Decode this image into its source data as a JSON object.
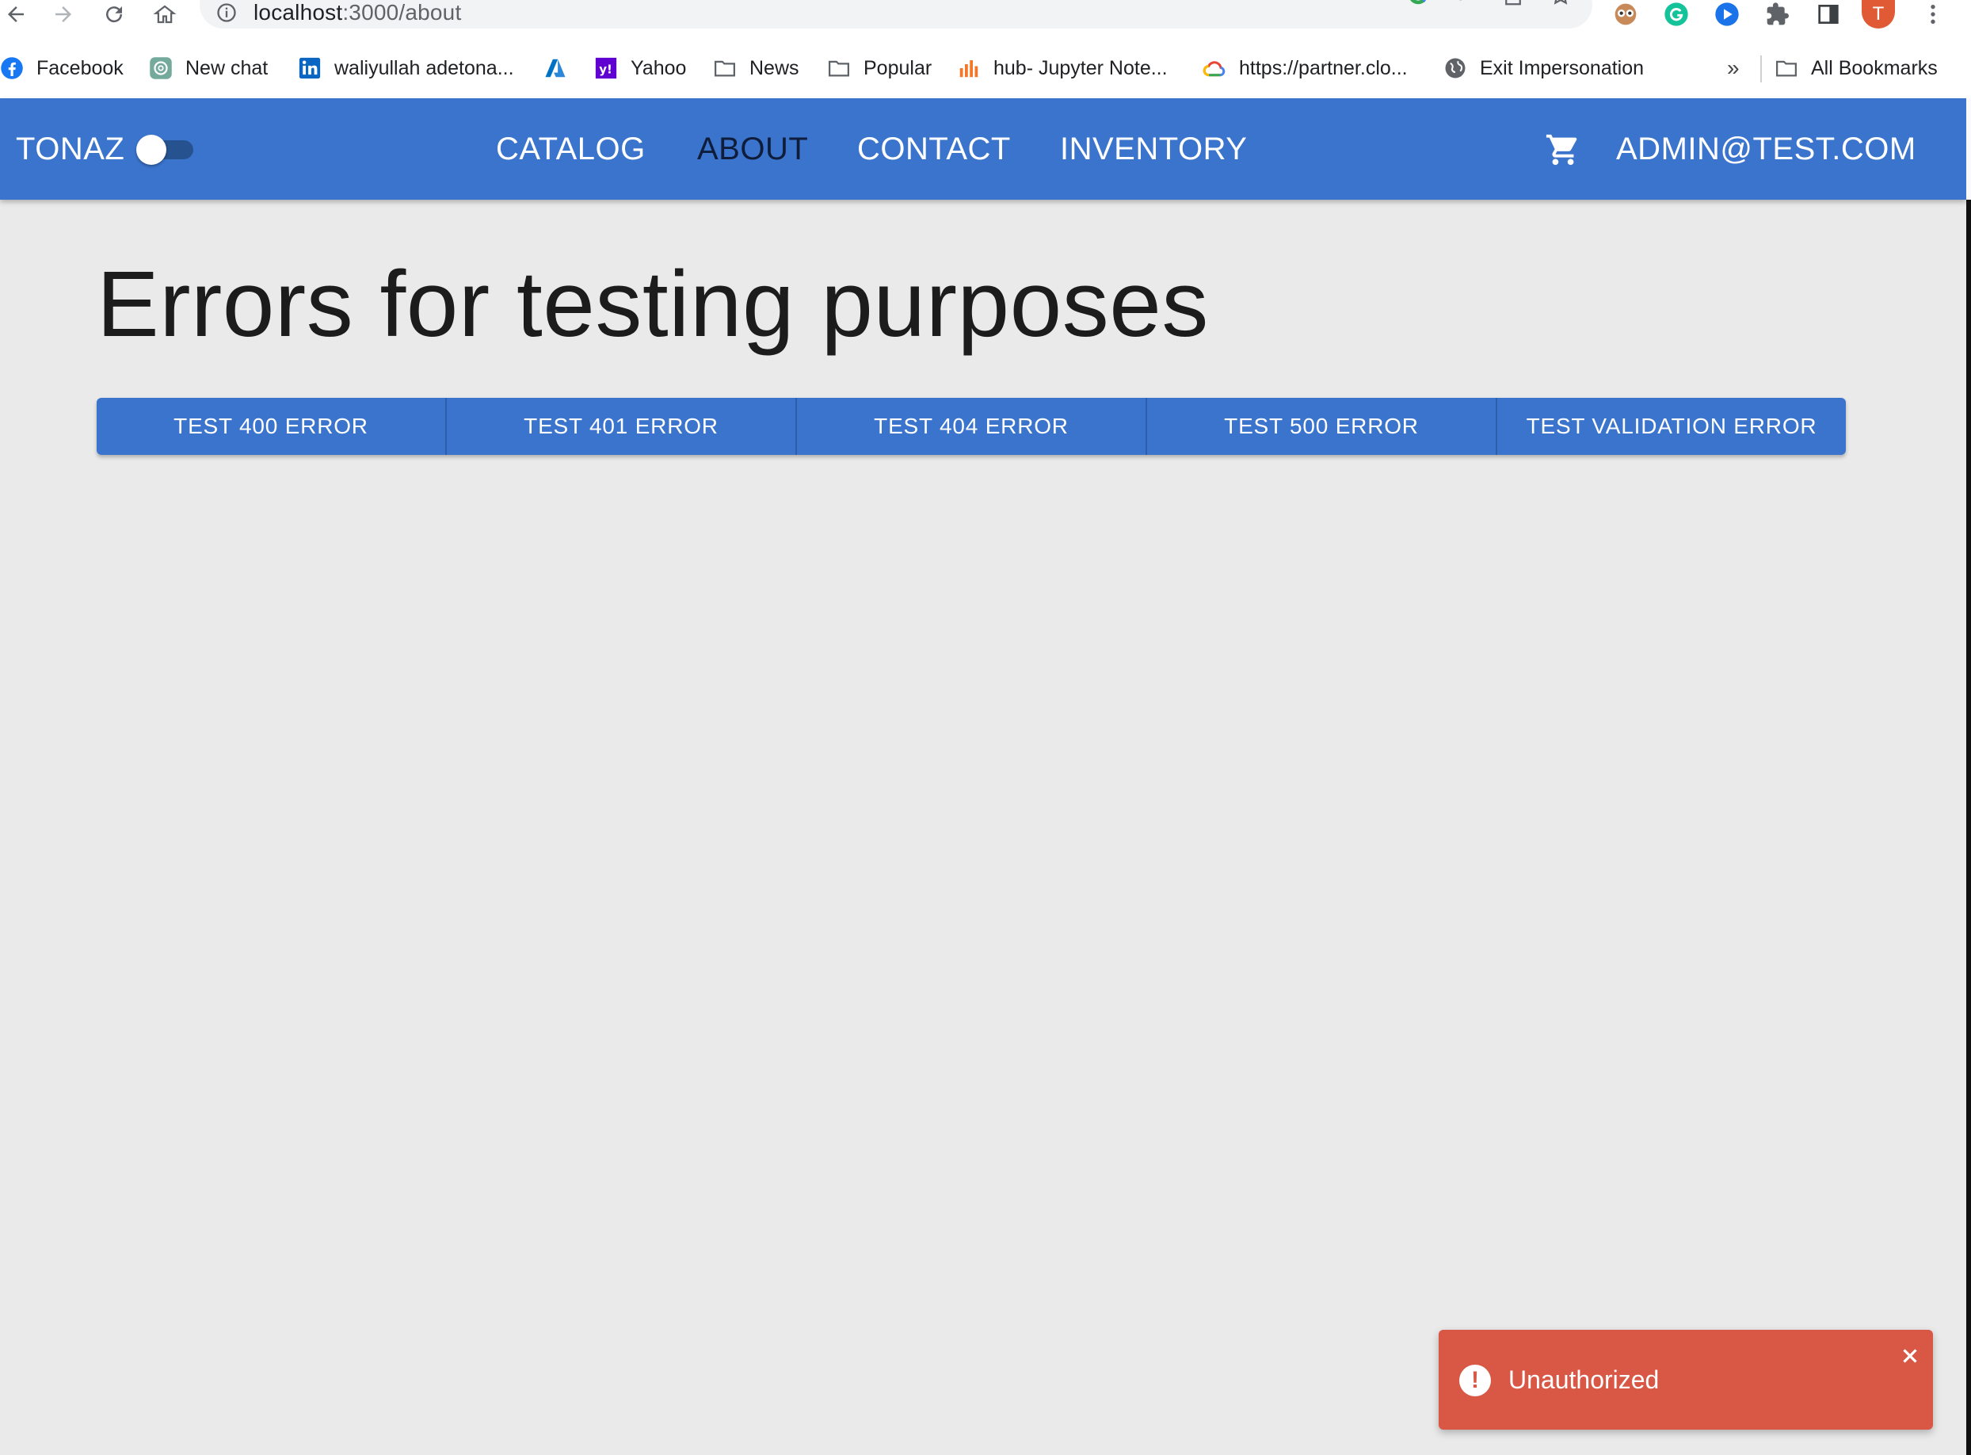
{
  "browser": {
    "url_host": "localhost",
    "url_path": ":3000/about",
    "profile_initial": "T"
  },
  "bookmarks": {
    "items": [
      {
        "label": "Facebook",
        "icon": "facebook-icon"
      },
      {
        "label": "New chat",
        "icon": "openai-icon"
      },
      {
        "label": "waliyullah adetona...",
        "icon": "linkedin-icon"
      },
      {
        "label": "",
        "icon": "azure-icon"
      },
      {
        "label": "Yahoo",
        "icon": "yahoo-icon"
      },
      {
        "label": "News",
        "icon": "folder-icon"
      },
      {
        "label": "Popular",
        "icon": "folder-icon"
      },
      {
        "label": "hub- Jupyter Note...",
        "icon": "chart-icon"
      },
      {
        "label": "https://partner.clo...",
        "icon": "cloud-icon"
      },
      {
        "label": "Exit Impersonation",
        "icon": "globe-icon"
      }
    ],
    "more": "»",
    "all_bookmarks": "All Bookmarks"
  },
  "appbar": {
    "brand": "TONAZ",
    "theme_switch_on": false,
    "nav": [
      "CATALOG",
      "ABOUT",
      "CONTACT",
      "INVENTORY"
    ],
    "active_nav": "ABOUT",
    "user": "ADMIN@TEST.COM",
    "color": "#3a74cc"
  },
  "main": {
    "title": "Errors for testing purposes",
    "buttons": [
      "TEST 400 ERROR",
      "TEST 401 ERROR",
      "TEST 404 ERROR",
      "TEST 500 ERROR",
      "TEST VALIDATION ERROR"
    ]
  },
  "toast": {
    "message": "Unauthorized",
    "color": "#d85745"
  }
}
